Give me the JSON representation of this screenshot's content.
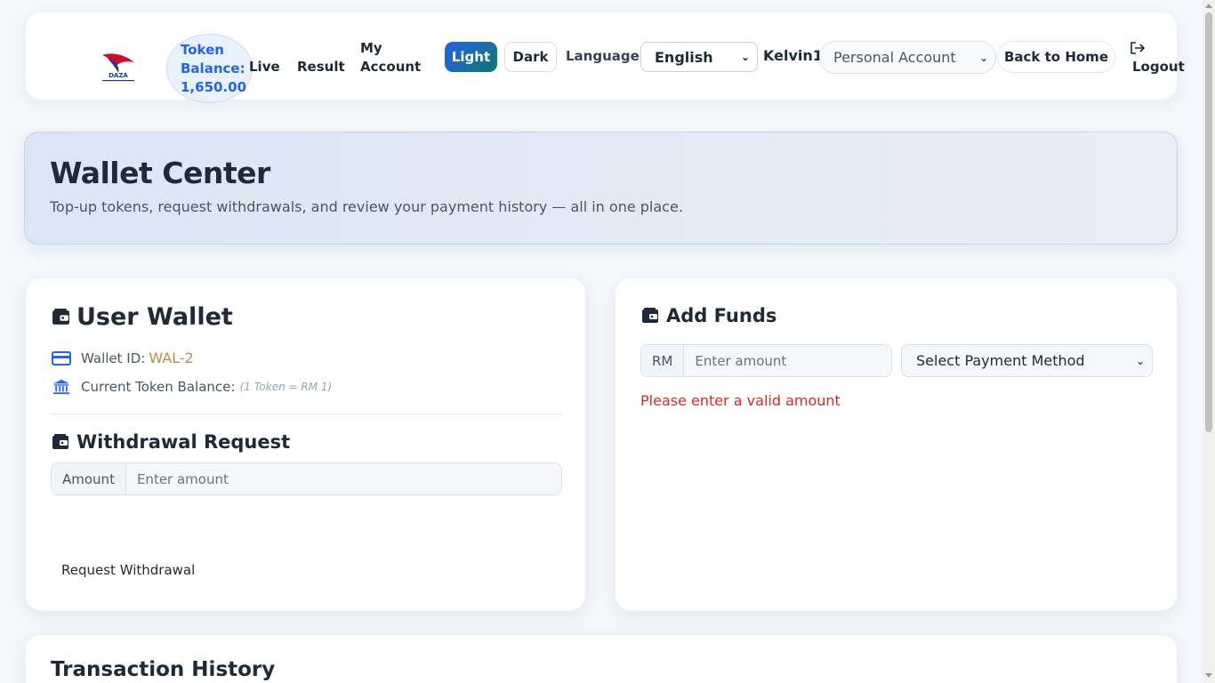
{
  "header": {
    "logo_text": "DAZA",
    "token_balance_label": "Token Balance:",
    "token_balance_value": "1,650.00",
    "nav": {
      "live": "Live",
      "result": "Result",
      "my_account": "My Account"
    },
    "theme": {
      "light": "Light",
      "dark": "Dark"
    },
    "language_label": "Language",
    "language_selected": "English",
    "username": "Kelvin1",
    "account_selected": "Personal Account",
    "back_home": "Back to Home",
    "logout": "Logout"
  },
  "hero": {
    "title": "Wallet Center",
    "subtitle": "Top-up tokens, request withdrawals, and review your payment history — all in one place."
  },
  "user_wallet": {
    "title": "User Wallet",
    "wallet_id_label": "Wallet ID:",
    "wallet_id_value": "WAL-2",
    "balance_label": "Current Token Balance:",
    "rate_note": "(1 Token = RM 1)",
    "withdrawal": {
      "title": "Withdrawal Request",
      "amount_label": "Amount",
      "amount_placeholder": "Enter amount",
      "submit": "Request Withdrawal"
    }
  },
  "add_funds": {
    "title": "Add Funds",
    "currency": "RM",
    "amount_placeholder": "Enter amount",
    "payment_method_selected": "Select Payment Method",
    "error": "Please enter a valid amount"
  },
  "history": {
    "title": "Transaction History"
  },
  "colors": {
    "accent": "#2563eb",
    "accent_teal": "#0f766e",
    "wallet_id": "#c28a4a",
    "error": "#dc2626"
  },
  "icons": {
    "wallet": "wallet-icon",
    "card": "credit-card-icon",
    "bank": "bank-icon",
    "logout": "logout-icon"
  }
}
